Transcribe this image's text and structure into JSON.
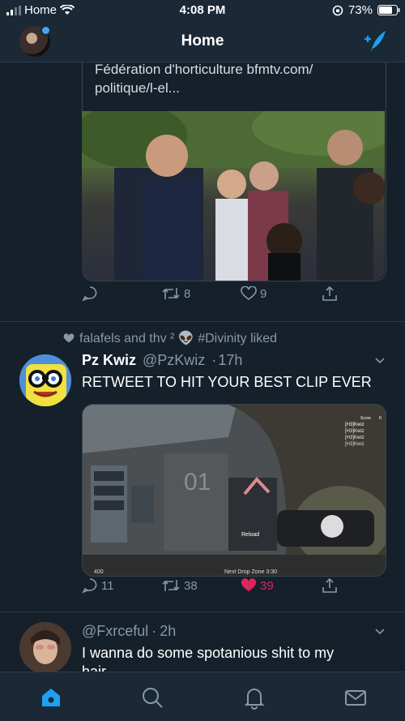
{
  "status_bar": {
    "carrier": "Home",
    "time": "4:08 PM",
    "battery": "73%"
  },
  "nav": {
    "title": "Home"
  },
  "tweet1": {
    "link_line1": "Fédération d'horticulture bfmtv.com/",
    "link_line2": "politique/l-el...",
    "retweets": "8",
    "likes": "9"
  },
  "tweet2": {
    "social_context": "falafels and thv ² 👽 #Divinity liked",
    "name": "Pz Kwiz",
    "handle": "@PzKwiz",
    "time": "17h",
    "text": "RETWEET TO HIT YOUR BEST CLIP EVER",
    "replies": "11",
    "retweets": "38",
    "likes": "39",
    "game_hud": {
      "score_label": "Score",
      "score_k": "K",
      "players": [
        "[H3]Kwiz",
        "[H3]Kwiz",
        "[H3]Kwiz",
        "[H3]Kwiz"
      ],
      "reload": "Reload",
      "drop_zone": "Next Drop Zone 3:30",
      "wall_number": "01",
      "ammo": "400"
    }
  },
  "tweet3": {
    "handle": "@Fxrceful",
    "time": "2h",
    "text": "I wanna do some spotanious shit to my",
    "text_cut": "hair"
  },
  "colors": {
    "accent": "#1da1f2",
    "like": "#e0245e",
    "bg": "#15202b",
    "bar": "#1b2836"
  },
  "icons": [
    "wifi-icon",
    "signal-icon",
    "battery-icon",
    "compose-icon",
    "reply-icon",
    "retweet-icon",
    "heart-icon",
    "share-icon",
    "chevron-down-icon",
    "home-icon",
    "search-icon",
    "bell-icon",
    "mail-icon"
  ]
}
